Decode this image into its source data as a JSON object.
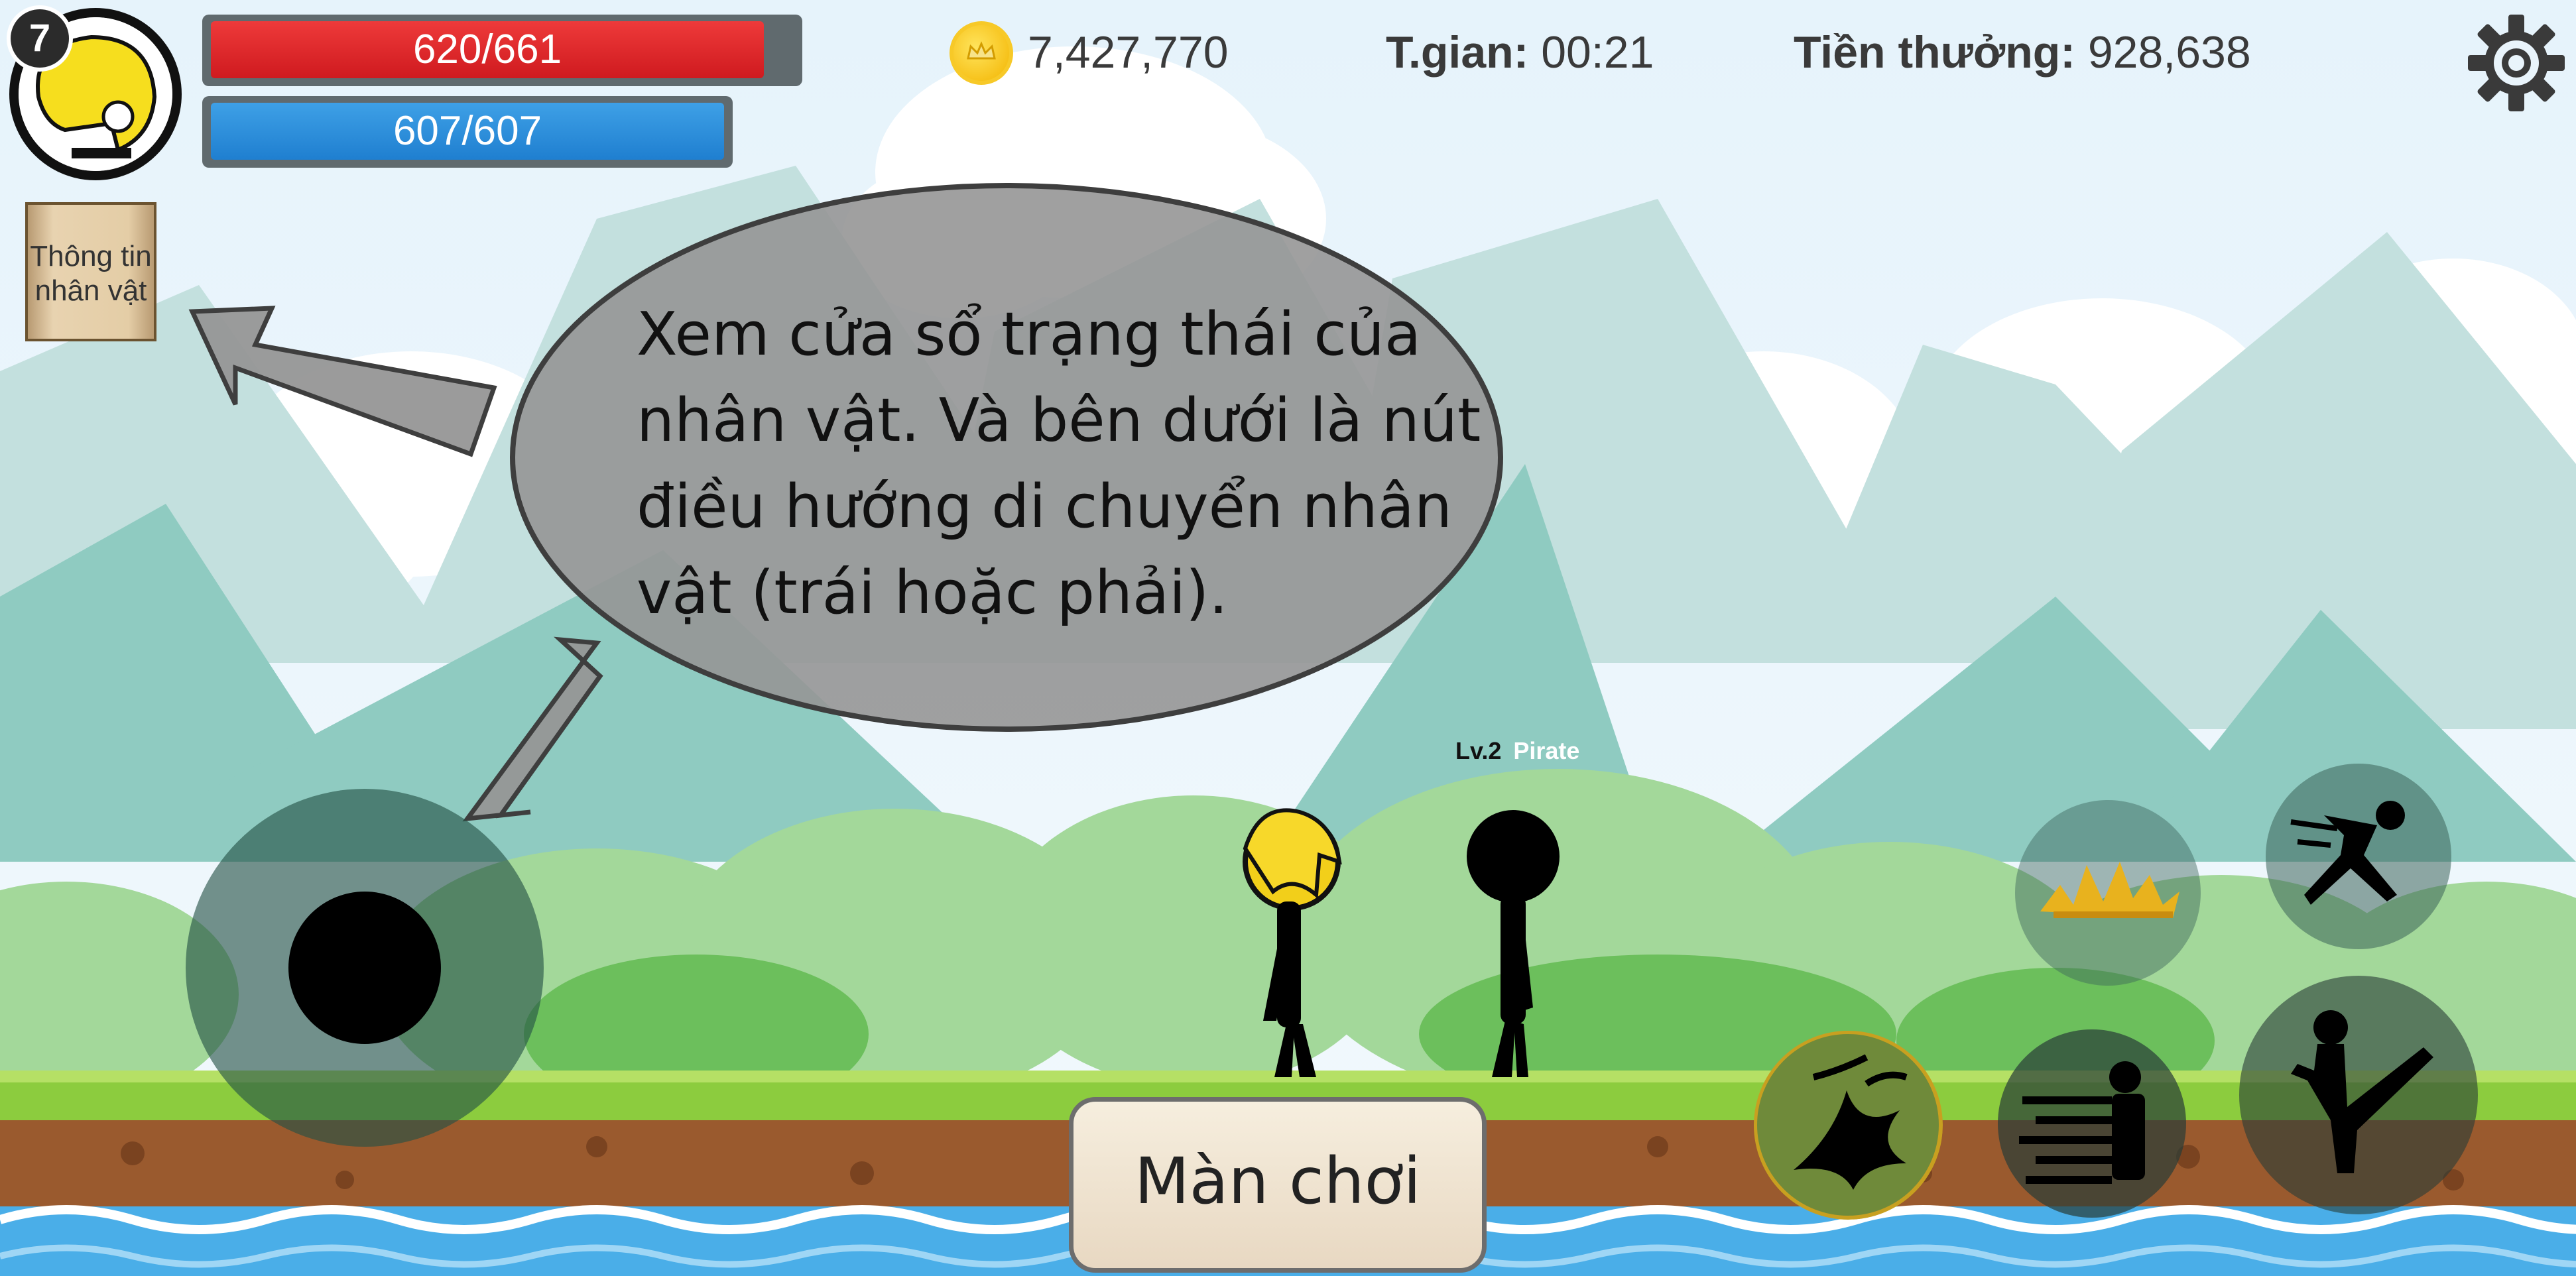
{
  "hud": {
    "level": "7",
    "hp_text": "620/661",
    "hp_fraction": 0.938,
    "mp_text": "607/607",
    "mp_fraction": 1.0,
    "coins": "7,427,770",
    "time_label": "T.gian:",
    "time_value": "00:21",
    "reward_label": "Tiền thưởng:",
    "reward_value": "928,638",
    "settings_icon": "gear-icon"
  },
  "character_info_button": {
    "label_line1": "Thông tin",
    "label_line2": "nhân vật"
  },
  "tutorial": {
    "text": "Xem cửa sổ trạng thái của nhân vật. Và bên dưới là nút điều hướng di chuyển nhân vật (trái hoặc phải)."
  },
  "enemy": {
    "level_label": "Lv.2",
    "name": "Pirate"
  },
  "skills": [
    "dash-kick-skill",
    "ground-burst-skill",
    "flame-slash-skill",
    "speed-punch-skill",
    "high-kick-skill"
  ],
  "stage_button": {
    "label": "Màn chơi"
  },
  "colors": {
    "hp": "#d92127",
    "mp": "#2a8bdc",
    "sky": "#e9f4fb",
    "grass": "#8ccc3e",
    "dirt": "#9a5a2e",
    "water": "#4aaee8"
  }
}
